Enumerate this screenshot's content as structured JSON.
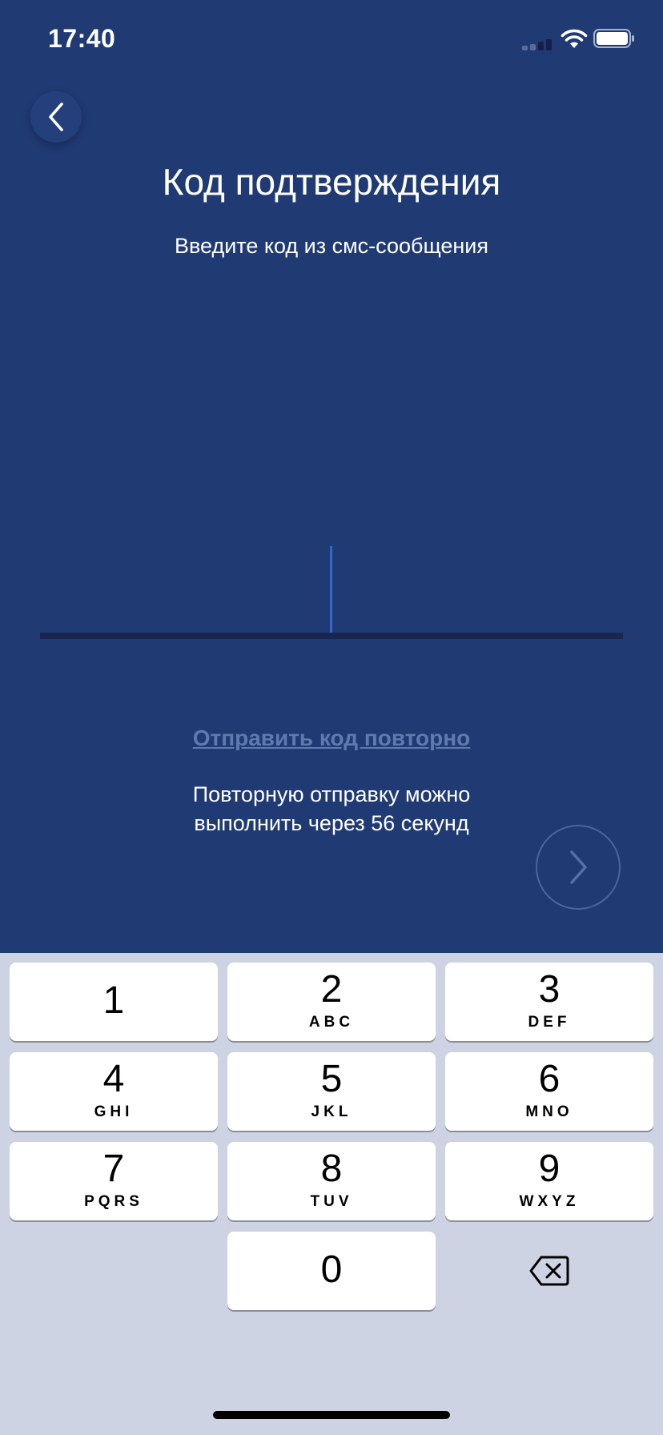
{
  "status_bar": {
    "time": "17:40"
  },
  "header": {
    "title": "Код подтверждения",
    "subtitle": "Введите код из смс-сообщения"
  },
  "code_input": {
    "value": ""
  },
  "resend": {
    "link_label": "Отправить код повторно",
    "info_line1": "Повторную отправку можно",
    "info_line2": "выполнить через 56 секунд"
  },
  "keypad": {
    "keys": [
      {
        "digit": "1",
        "letters": ""
      },
      {
        "digit": "2",
        "letters": "ABC"
      },
      {
        "digit": "3",
        "letters": "DEF"
      },
      {
        "digit": "4",
        "letters": "GHI"
      },
      {
        "digit": "5",
        "letters": "JKL"
      },
      {
        "digit": "6",
        "letters": "MNO"
      },
      {
        "digit": "7",
        "letters": "PQRS"
      },
      {
        "digit": "8",
        "letters": "TUV"
      },
      {
        "digit": "9",
        "letters": "WXYZ"
      },
      {
        "digit": "0",
        "letters": ""
      }
    ]
  },
  "colors": {
    "background": "#203a74",
    "keypad_background": "#cdd3e2",
    "cursor": "#3a64c8",
    "link": "#5f7aae"
  },
  "icons": {
    "back": "chevron-left-icon",
    "next": "chevron-right-icon",
    "backspace": "backspace-icon",
    "wifi": "wifi-icon",
    "battery": "battery-icon",
    "signal": "signal-icon"
  }
}
